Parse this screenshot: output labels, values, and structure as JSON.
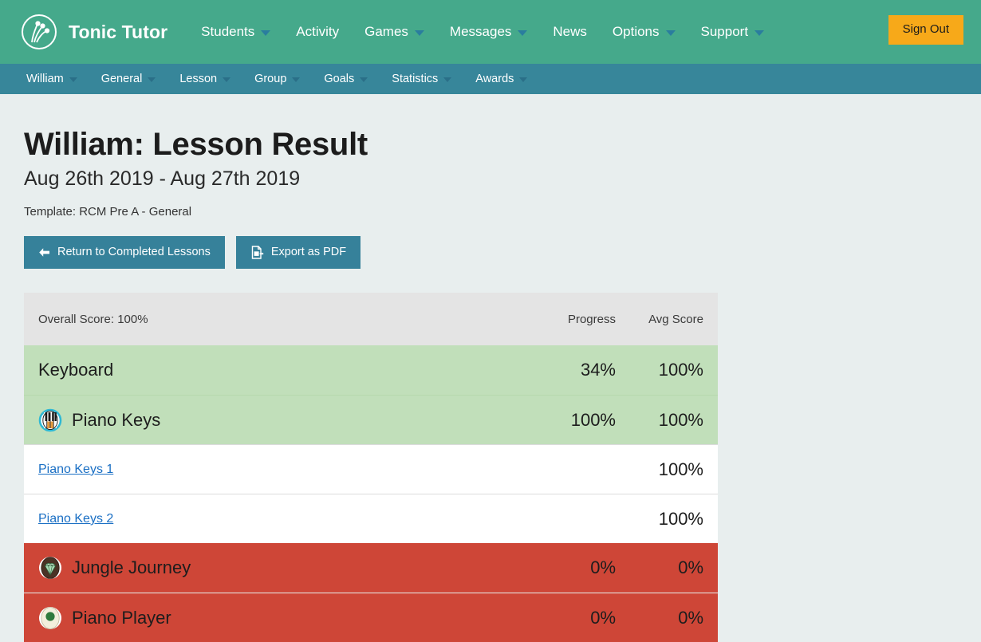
{
  "brand": {
    "name": "Tonic Tutor",
    "logo_icon": "tonic-tutor-logo-icon"
  },
  "topnav": {
    "background": "#45a98b",
    "items": [
      {
        "label": "Students",
        "has_caret": true
      },
      {
        "label": "Activity",
        "has_caret": false
      },
      {
        "label": "Games",
        "has_caret": true
      },
      {
        "label": "Messages",
        "has_caret": true
      },
      {
        "label": "News",
        "has_caret": false
      },
      {
        "label": "Options",
        "has_caret": true
      },
      {
        "label": "Support",
        "has_caret": true
      }
    ],
    "signout_label": "Sign Out",
    "signout_color": "#f7a919"
  },
  "subnav": {
    "background": "#37869a",
    "items": [
      {
        "label": "William",
        "has_caret": true
      },
      {
        "label": "General",
        "has_caret": true
      },
      {
        "label": "Lesson",
        "has_caret": true
      },
      {
        "label": "Group",
        "has_caret": true
      },
      {
        "label": "Goals",
        "has_caret": true
      },
      {
        "label": "Statistics",
        "has_caret": true
      },
      {
        "label": "Awards",
        "has_caret": true
      }
    ]
  },
  "header": {
    "title": "William: Lesson Result",
    "date_range": "Aug 26th 2019 - Aug 27th 2019",
    "template": "Template: RCM Pre A - General"
  },
  "actions": {
    "return_label": "Return to Completed Lessons",
    "return_icon": "arrow-left-icon",
    "export_label": "Export as PDF",
    "export_icon": "file-export-icon",
    "button_color": "#36819a"
  },
  "results_table": {
    "header": {
      "title": "Overall Score: 100%",
      "col_progress": "Progress",
      "col_avg_score": "Avg Score",
      "background": "#e4e4e4"
    },
    "colors": {
      "pass": "#c1dfba",
      "fail": "#ce4637",
      "plain": "#ffffff"
    },
    "rows": [
      {
        "level": 1,
        "name": "Keyboard",
        "progress": "34%",
        "avg_score": "100%",
        "state": "pass",
        "icon": null,
        "link": false
      },
      {
        "level": 2,
        "name": "Piano Keys",
        "progress": "100%",
        "avg_score": "100%",
        "state": "pass",
        "icon": "piano-keys-game-icon",
        "link": false
      },
      {
        "level": 3,
        "name": "Piano Keys 1",
        "progress": "",
        "avg_score": "100%",
        "state": "plain",
        "icon": null,
        "link": true
      },
      {
        "level": 3,
        "name": "Piano Keys 2",
        "progress": "",
        "avg_score": "100%",
        "state": "plain",
        "icon": null,
        "link": true
      },
      {
        "level": 2,
        "name": "Jungle Journey",
        "progress": "0%",
        "avg_score": "0%",
        "state": "fail",
        "icon": "jungle-journey-game-icon",
        "link": false
      },
      {
        "level": 2,
        "name": "Piano Player",
        "progress": "0%",
        "avg_score": "0%",
        "state": "fail",
        "icon": "piano-player-game-icon",
        "link": false
      }
    ]
  }
}
